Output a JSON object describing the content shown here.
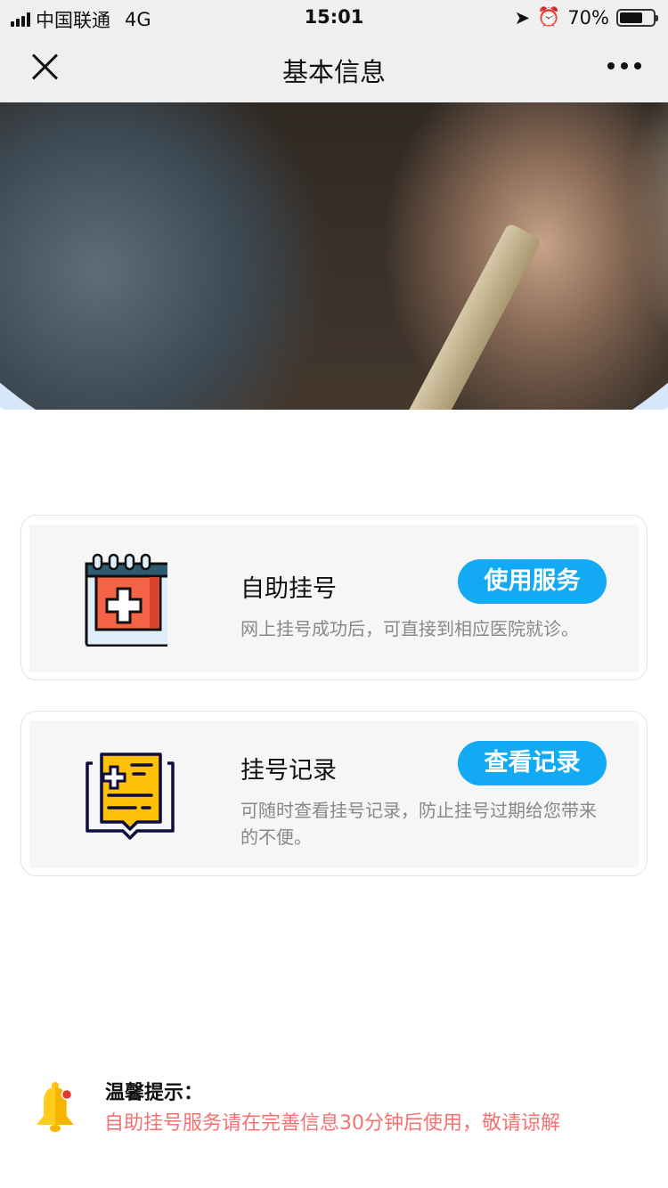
{
  "status": {
    "carrier": "中国联通",
    "network": "4G",
    "time": "15:01",
    "battery": "70%"
  },
  "nav": {
    "title": "基本信息"
  },
  "services": [
    {
      "name": "自助挂号",
      "button": "使用服务",
      "desc": "网上挂号成功后，可直接到相应医院就诊。"
    },
    {
      "name": "挂号记录",
      "button": "查看记录",
      "desc": "可随时查看挂号记录，防止挂号过期给您带来的不便。"
    }
  ],
  "tip": {
    "heading": "温馨提示：",
    "message": "自助挂号服务请在完善信息30分钟后使用，敬请谅解"
  },
  "colors": {
    "accent": "#12aaf5",
    "warning": "#f67171"
  }
}
